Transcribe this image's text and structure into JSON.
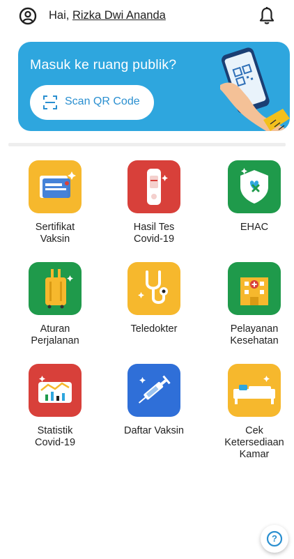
{
  "header": {
    "greeting_prefix": "Hai, ",
    "user_name": "Rizka Dwi Ananda",
    "profile_icon": "account-circle-icon",
    "notification_icon": "bell-icon"
  },
  "banner": {
    "title": "Masuk ke ruang publik?",
    "scan_button_label": "Scan QR Code",
    "background_color": "#2ea6de",
    "scan_icon": "qr-scan-icon"
  },
  "menu": {
    "items": [
      {
        "label": "Sertifikat\nVaksin",
        "icon": "certificate-icon",
        "color": "#f6b82d"
      },
      {
        "label": "Hasil Tes\nCovid-19",
        "icon": "test-kit-icon",
        "color": "#d8403a"
      },
      {
        "label": "EHAC",
        "icon": "shield-icon",
        "color": "#1f9a4b"
      },
      {
        "label": "Aturan\nPerjalanan",
        "icon": "suitcase-icon",
        "color": "#1f9a4b"
      },
      {
        "label": "Teledokter",
        "icon": "stethoscope-icon",
        "color": "#f6b82d"
      },
      {
        "label": "Pelayanan\nKesehatan",
        "icon": "hospital-icon",
        "color": "#1f9a4b"
      },
      {
        "label": "Statistik\nCovid-19",
        "icon": "chart-icon",
        "color": "#d8403a"
      },
      {
        "label": "Daftar Vaksin",
        "icon": "syringe-icon",
        "color": "#2f6fd8"
      },
      {
        "label": "Cek\nKetersediaan\nKamar",
        "icon": "bed-icon",
        "color": "#f6b82d"
      }
    ]
  },
  "help": {
    "icon": "help-icon",
    "glyph": "?"
  }
}
